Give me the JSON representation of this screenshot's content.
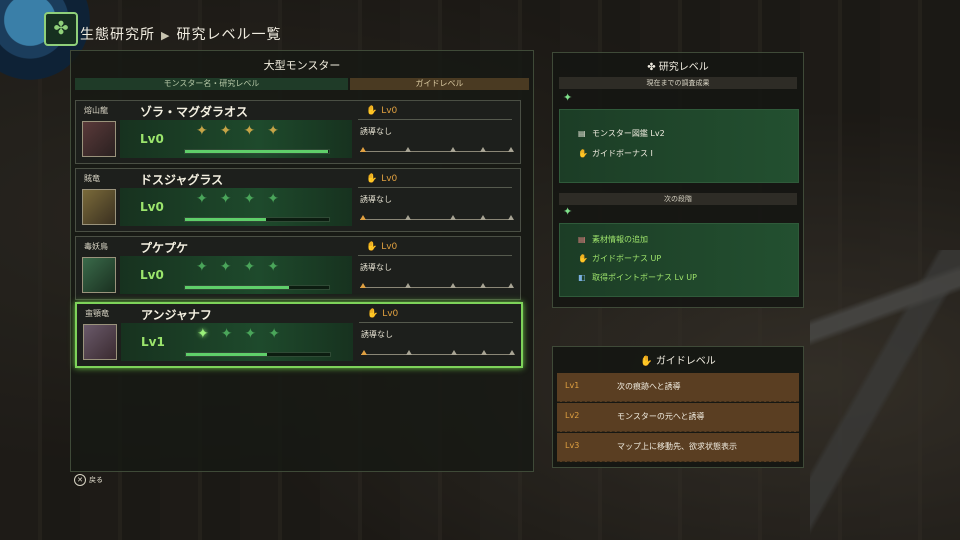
{
  "header": {
    "section": "生態研究所",
    "page": "研究レベル一覧"
  },
  "large_monsters": {
    "title": "大型モンスター",
    "col_name": "モンスター名・研究レベル",
    "col_guide": "ガイドレベル",
    "rows": [
      {
        "category": "熔山龍",
        "name": "ゾラ・マグダラオス",
        "level": "Lv0",
        "guide_level": "Lv0",
        "guide_status": "誘導なし",
        "progress": 0.99
      },
      {
        "category": "賊竜",
        "name": "ドスジャグラス",
        "level": "Lv0",
        "guide_level": "Lv0",
        "guide_status": "誘導なし",
        "progress": 0.56
      },
      {
        "category": "毒妖鳥",
        "name": "プケプケ",
        "level": "Lv0",
        "guide_level": "Lv0",
        "guide_status": "誘導なし",
        "progress": 0.72
      },
      {
        "category": "蛮顎竜",
        "name": "アンジャナフ",
        "level": "Lv1",
        "guide_level": "Lv0",
        "guide_status": "誘導なし",
        "progress": 0.56
      }
    ]
  },
  "research": {
    "title": "研究レベル",
    "current_label": "現在までの調査成果",
    "current_items": [
      "モンスター図鑑 Lv2",
      "ガイドボーナス Ⅰ"
    ],
    "next_label": "次の段階",
    "next_items": [
      "素材情報の追加",
      "ガイドボーナス UP",
      "取得ポイントボーナス Lv UP"
    ]
  },
  "guide": {
    "title": "ガイドレベル",
    "levels": [
      {
        "lv": "Lv1",
        "text": "次の痕跡へと誘導"
      },
      {
        "lv": "Lv2",
        "text": "モンスターの元へと誘導"
      },
      {
        "lv": "Lv3",
        "text": "マップ上に移動先、欲求状態表示"
      }
    ]
  },
  "footer": {
    "back_label": "戻る"
  },
  "icons": {
    "guide": "paw-icon",
    "back": "cross-button-icon"
  }
}
